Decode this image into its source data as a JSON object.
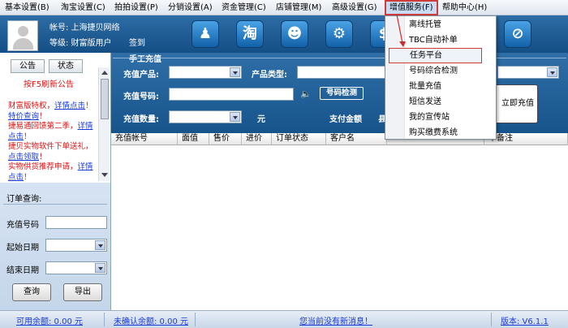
{
  "menu": [
    "基本设置(B)",
    "淘宝设置(C)",
    "拍拍设置(P)",
    "分销设置(A)",
    "资金管理(C)",
    "店铺管理(M)",
    "高级设置(G)",
    "增值服务(F)",
    "帮助中心(H)"
  ],
  "header": {
    "account_label": "帐号: 上海捷贝网络",
    "level_label": "等级: 财富版用户",
    "signin": "签到",
    "tool_icons": [
      "user-service",
      "taobao",
      "qq",
      "gears",
      "money",
      "network",
      "fullscreen",
      "disable"
    ]
  },
  "left": {
    "tab_notice": "公告",
    "tab_status": "状态",
    "f5_hint": "按F5刷新公告",
    "notice_lines": [
      {
        "text": "财富版特权，",
        "cls": "red"
      },
      {
        "text": "详情点击",
        "cls": "link"
      },
      {
        "text": "！",
        "cls": "red"
      },
      {
        "text": "特价查询",
        "cls": "link"
      },
      {
        "text": "！",
        "cls": "red"
      },
      {
        "text": "捷易通回馈第二季，",
        "cls": "red"
      },
      {
        "text": "详情点击",
        "cls": "link"
      },
      {
        "text": "！",
        "cls": "red"
      },
      {
        "text": "捷贝实物软件下单送礼，",
        "cls": "red"
      },
      {
        "text": "点击领取",
        "cls": "link"
      },
      {
        "text": "！",
        "cls": "red"
      },
      {
        "text": "实物供货推荐申请，",
        "cls": "red"
      },
      {
        "text": "详情点击",
        "cls": "link"
      },
      {
        "text": "！",
        "cls": "red"
      }
    ],
    "order_query_title": "订单查询:",
    "phone_label": "充值号码",
    "start_label": "起始日期",
    "end_label": "结束日期",
    "query_button": "查询",
    "export_button": "导出"
  },
  "recharge": {
    "title": "手工充值",
    "product_label": "充值产品:",
    "type_label": "产品类型:",
    "number_label": "充值号码:",
    "detect_button": "号码检测",
    "qty_label": "充值数量:",
    "unit": "元",
    "pay_label": "支付金额",
    "pay_value_cut": "县",
    "submit_button": "立即充值"
  },
  "table": {
    "columns": [
      "充值帐号",
      "面值",
      "售价",
      "进价",
      "订单状态",
      "客户名",
      "",
      "单备注"
    ]
  },
  "dropdown": {
    "items": [
      "离线托管",
      "TBC自动补单",
      "任务平台",
      "号码综合检测",
      "批量充值",
      "短信发送",
      "我的宣传站",
      "购买缴费系统"
    ],
    "highlighted_index": 2
  },
  "status": {
    "available": "可用余额: 0.00 元",
    "unconfirmed": "未确认余额: 0.00 元",
    "message": "您当前没有新消息！",
    "version": "版本: V6.1.1"
  },
  "colors": {
    "highlight_border": "#d13b3b",
    "header_blue": "#1f5f99",
    "link_blue": "#1a3bd6"
  }
}
